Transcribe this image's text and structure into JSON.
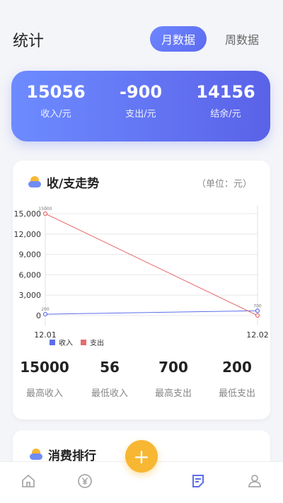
{
  "header": {
    "title": "统计",
    "tabs": [
      {
        "label": "月数据"
      },
      {
        "label": "周数据"
      }
    ]
  },
  "summary": [
    {
      "value": "15056",
      "label": "收入/元"
    },
    {
      "value": "-900",
      "label": "支出/元"
    },
    {
      "value": "14156",
      "label": "结余/元"
    }
  ],
  "trend": {
    "title": "收/支走势",
    "unit": "（单位：元）",
    "chart_data": {
      "type": "line",
      "x": [
        "12.01",
        "12.02"
      ],
      "series": [
        {
          "name": "收入",
          "values": [
            200,
            700
          ],
          "color": "#5b6ee8"
        },
        {
          "name": "支出",
          "values": [
            15000,
            0
          ],
          "color": "#e86b6b"
        }
      ],
      "yticks": [
        0,
        3000,
        6000,
        9000,
        12000,
        15000
      ],
      "ylim": [
        0,
        15000
      ],
      "legend": "bottom",
      "point_labels": {
        "income": [
          "200",
          "700"
        ],
        "expense": [
          "15000",
          ""
        ]
      }
    },
    "stats": [
      {
        "value": "15000",
        "label": "最高收入"
      },
      {
        "value": "56",
        "label": "最低收入"
      },
      {
        "value": "700",
        "label": "最高支出"
      },
      {
        "value": "200",
        "label": "最低支出"
      }
    ]
  },
  "ranking": {
    "title": "消费排行"
  },
  "fab": {
    "label": "+"
  },
  "tabbar": {
    "icons": [
      "home-icon",
      "yen-icon",
      "report-icon",
      "user-icon"
    ],
    "active": "report-icon"
  }
}
